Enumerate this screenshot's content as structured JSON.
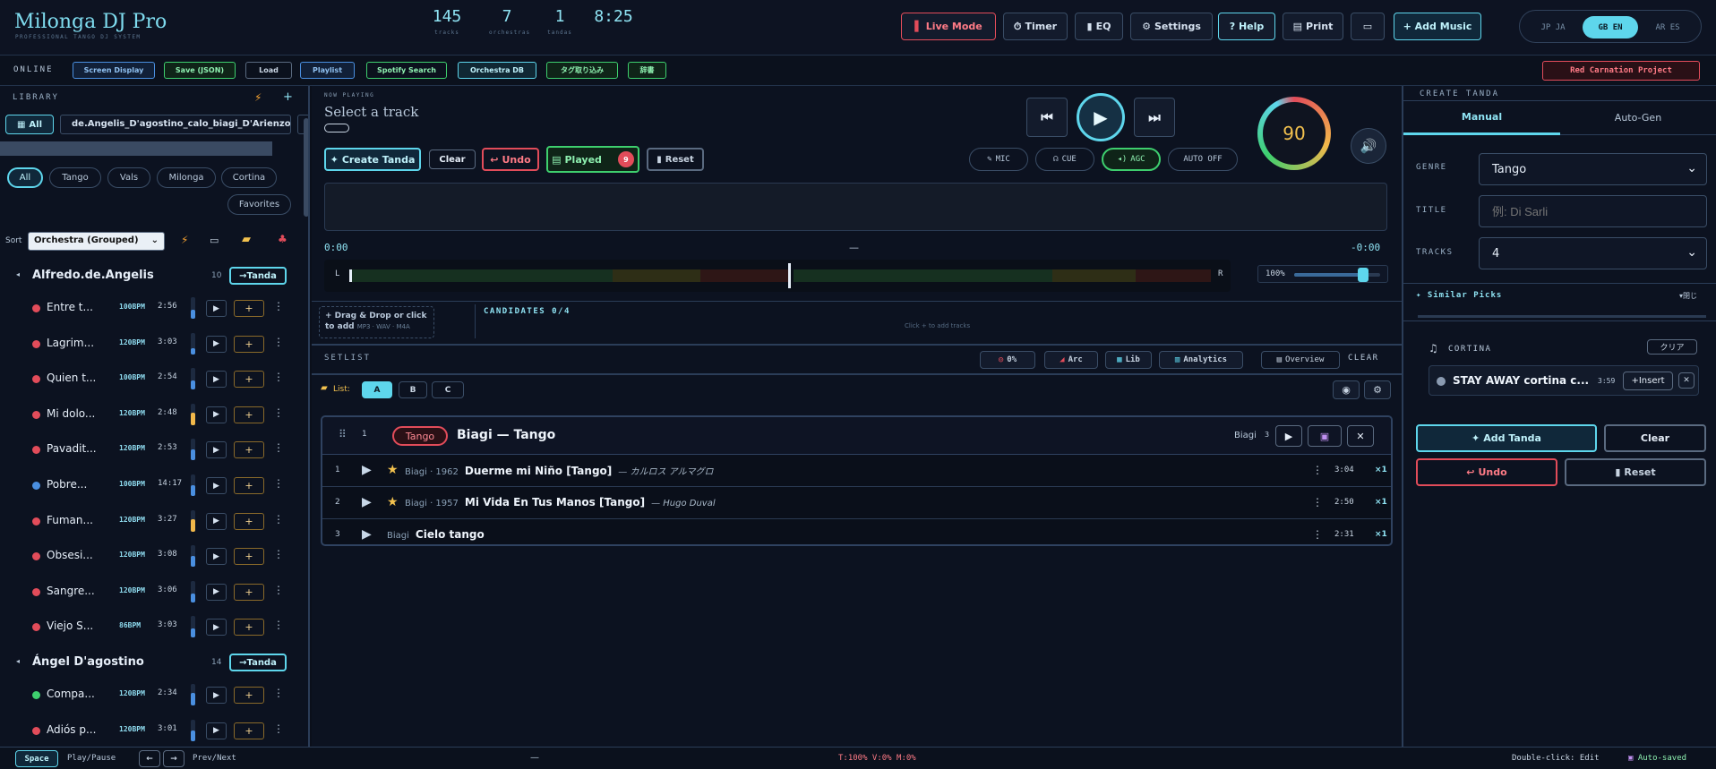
{
  "app": {
    "title": "Milonga DJ Pro",
    "subtitle": "PROFESSIONAL TANGO DJ SYSTEM"
  },
  "stats": [
    {
      "value": "145",
      "label": "tracks"
    },
    {
      "value": "7",
      "label": "orchestras"
    },
    {
      "value": "1",
      "label": "tandas"
    },
    {
      "value": "8:25",
      "label": ""
    }
  ],
  "header_buttons": {
    "live": "Live Mode",
    "timer": "Timer",
    "eq": "EQ",
    "settings": "Settings",
    "help": "? Help",
    "print": "Print",
    "screen": "▭",
    "add_music": "+ Add Music"
  },
  "languages": [
    "JP JA",
    "GB EN",
    "AR ES"
  ],
  "toolbar": {
    "online": "ONLINE",
    "screen_display": "Screen Display",
    "save": "Save (JSON)",
    "load": "Load",
    "playlist": "Playlist",
    "spotify": "Spotify Search",
    "orchestra_db": "Orchestra DB",
    "tag": "タグ取り込み",
    "dict": "辞書",
    "red_carnation": "Red Carnation Project"
  },
  "library": {
    "title": "LIBRARY",
    "all_label": "All",
    "search_value": "de.Angelis_D'agostino_calo_biagi_D'Arienzo",
    "filters": [
      "All",
      "Tango",
      "Vals",
      "Milonga",
      "Cortina",
      "Favorites"
    ],
    "sort_label": "Sort",
    "sort_value": "Orchestra (Grouped)",
    "groups": [
      {
        "name": "Alfredo.de.Angelis",
        "count": "10",
        "tanda_btn": "→Tanda",
        "tracks": [
          {
            "name": "Entre t...",
            "bpm": "100BPM",
            "dur": "2:56",
            "color": "#e24c5a",
            "level": 0.4,
            "lvl_color": "#4a8fe0"
          },
          {
            "name": "Lagrim...",
            "bpm": "120BPM",
            "dur": "3:03",
            "color": "#e24c5a",
            "level": 0.3,
            "lvl_color": "#4a8fe0"
          },
          {
            "name": "Quien t...",
            "bpm": "100BPM",
            "dur": "2:54",
            "color": "#e24c5a",
            "level": 0.4,
            "lvl_color": "#4a8fe0"
          },
          {
            "name": "Mi dolo...",
            "bpm": "120BPM",
            "dur": "2:48",
            "color": "#e24c5a",
            "level": 0.6,
            "lvl_color": "#f2b84a"
          },
          {
            "name": "Pavadit...",
            "bpm": "120BPM",
            "dur": "2:53",
            "color": "#e24c5a",
            "level": 0.5,
            "lvl_color": "#4a8fe0"
          },
          {
            "name": "Pobre...",
            "bpm": "100BPM",
            "dur": "14:17",
            "color": "#4a8fe0",
            "level": 0.5,
            "lvl_color": "#4a8fe0"
          },
          {
            "name": "Fuman...",
            "bpm": "120BPM",
            "dur": "3:27",
            "color": "#e24c5a",
            "level": 0.6,
            "lvl_color": "#f2b84a"
          },
          {
            "name": "Obsesi...",
            "bpm": "120BPM",
            "dur": "3:08",
            "color": "#e24c5a",
            "level": 0.5,
            "lvl_color": "#4a8fe0"
          },
          {
            "name": "Sangre...",
            "bpm": "120BPM",
            "dur": "3:06",
            "color": "#e24c5a",
            "level": 0.4,
            "lvl_color": "#4a8fe0"
          },
          {
            "name": "Viejo S...",
            "bpm": "86BPM",
            "dur": "3:03",
            "color": "#e24c5a",
            "level": 0.4,
            "lvl_color": "#4a8fe0"
          }
        ]
      },
      {
        "name": "Ángel D'agostino",
        "count": "14",
        "tanda_btn": "→Tanda",
        "tracks": [
          {
            "name": "Compa...",
            "bpm": "120BPM",
            "dur": "2:34",
            "color": "#3ecf6e",
            "level": 0.6,
            "lvl_color": "#4a8fe0"
          },
          {
            "name": "Adiós p...",
            "bpm": "120BPM",
            "dur": "3:01",
            "color": "#e24c5a",
            "level": 0.5,
            "lvl_color": "#4a8fe0"
          }
        ]
      }
    ]
  },
  "player": {
    "now_playing_label": "NOW PLAYING",
    "title": "Select a track",
    "create_tanda": "Create Tanda",
    "clear": "Clear",
    "undo": "Undo",
    "played": "Played",
    "played_count": "9",
    "reset": "Reset",
    "bpm": "90",
    "mic": "MIC",
    "cue": "CUE",
    "agc": "AGC",
    "auto": "AUTO OFF",
    "time_start": "0:00",
    "time_mid": "—",
    "time_end": "-0:00",
    "vol": "100%",
    "vol_level": 0.8,
    "L": "L",
    "R": "R"
  },
  "candidates": {
    "drop": "+ Drag & Drop or click to add",
    "formats": "MP3 · WAV · M4A",
    "label": "CANDIDATES 0/4",
    "hint": "Click + to add tracks"
  },
  "setlist": {
    "title": "SETLIST",
    "pct": "0%",
    "arc": "Arc",
    "lib": "Lib",
    "analytics": "Analytics",
    "overview": "Overview",
    "clear": "CLEAR",
    "list_label": "List:",
    "lists": [
      "A",
      "B",
      "C"
    ],
    "tanda": {
      "num": "1",
      "genre": "Tango",
      "name": "Biagi — Tango",
      "orchestra": "Biagi",
      "count": "3",
      "tracks": [
        {
          "n": "1",
          "star": true,
          "meta": "Biagi · 1962",
          "title": "Duerme mi Niño [Tango]",
          "artist": "— カルロス アルマグロ",
          "dur": "3:04",
          "x": "×1"
        },
        {
          "n": "2",
          "star": true,
          "meta": "Biagi · 1957",
          "title": "Mi Vida En Tus Manos [Tango]",
          "artist": "— Hugo Duval",
          "dur": "2:50",
          "x": "×1"
        },
        {
          "n": "3",
          "star": false,
          "meta": "Biagi",
          "title": "Cielo tango",
          "artist": "",
          "dur": "2:31",
          "x": "×1"
        }
      ]
    }
  },
  "create_tanda": {
    "title": "CREATE TANDA",
    "tab_manual": "Manual",
    "tab_auto": "Auto-Gen",
    "genre_label": "GENRE",
    "genre_value": "Tango",
    "title_label": "TITLE",
    "title_placeholder": "例: Di Sarli",
    "tracks_label": "TRACKS",
    "tracks_value": "4",
    "similar": "Similar Picks",
    "similar_toggle": "▾閉じ",
    "cortina_label": "CORTINA",
    "cortina_clear": "クリア",
    "cortina_track": "STAY AWAY cortina c...",
    "cortina_dur": "3:59",
    "insert": "+Insert",
    "add_tanda": "Add Tanda",
    "clear": "Clear",
    "undo": "Undo",
    "reset": "Reset"
  },
  "footer": {
    "space": "Space",
    "play_pause": "Play/Pause",
    "left": "←",
    "right": "→",
    "prev_next": "Prev/Next",
    "dash": "—",
    "status": "T:100% V:0% M:0%",
    "dblclick": "Double-click: Edit",
    "autosaved": "Auto-saved"
  }
}
